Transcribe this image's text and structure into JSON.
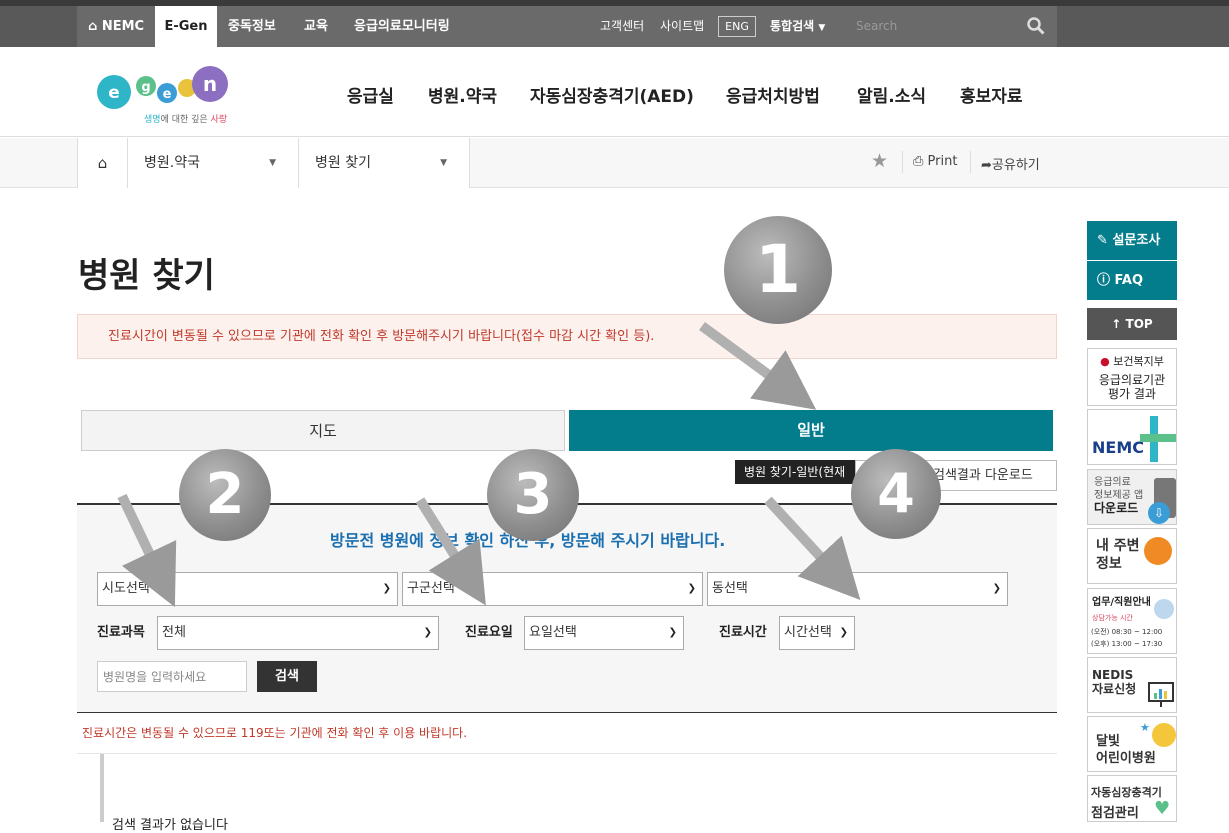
{
  "topbar": {
    "nav": [
      {
        "label": "NEMC",
        "icon": "home-icon"
      },
      {
        "label": "E-Gen"
      },
      {
        "label": "중독정보"
      },
      {
        "label": "교육"
      },
      {
        "label": "응급의료모니터링"
      }
    ],
    "links": {
      "customer": "고객센터",
      "sitemap": "사이트맵",
      "eng": "ENG",
      "integrated_search": "통합검색"
    },
    "search_placeholder": "Search"
  },
  "logo": {
    "tagline_1": "생명",
    "tagline_2": "에 대한 깊은 ",
    "tagline_3": "사랑"
  },
  "gnb": [
    "응급실",
    "병원.약국",
    "자동심장충격기(AED)",
    "응급처치방법",
    "알림.소식",
    "홍보자료"
  ],
  "breadcrumb": {
    "level1": "병원.약국",
    "level2": "병원 찾기",
    "print": "Print",
    "share": "공유하기"
  },
  "page": {
    "title": "병원 찾기",
    "notice": "진료시간이 변동될 수 있으므로 기관에 전화 확인 후 방문해주시기 바랍니다(접수 마감 시간 확인 등).",
    "tabs": {
      "map": "지도",
      "general": "일반"
    },
    "tooltip": "병원 찾기-일반(현재",
    "download": "검색결과 다운로드",
    "guide": "방문전 병원에 정보 확인 하신 후, 방문해 주시기 바랍니다.",
    "selects": {
      "sido": "시도선택",
      "gugun": "구군선택",
      "dong": "동선택",
      "dept": "전체",
      "day": "요일선택",
      "time": "시간선택"
    },
    "labels": {
      "dept": "진료과목",
      "day": "진료요일",
      "time": "진료시간"
    },
    "name_placeholder": "병원명을 입력하세요",
    "search_button": "검색",
    "warning": "진료시간은 변동될 수 있으므로 119또는 기관에 전화 확인 후 이용 바랍니다.",
    "result_message": "검색 결과가 없습니다"
  },
  "quick": {
    "survey": "설문조사",
    "faq": "FAQ",
    "top": "TOP",
    "banners": {
      "mohw_org": "보건복지부",
      "mohw_line1": "응급의료기관",
      "mohw_line2": "평가 결과",
      "nemc": "NEMC",
      "app_line1": "응급의료",
      "app_line2": "정보제공 앱",
      "app_line3": "다운로드",
      "near_line1": "내 주변",
      "near_line2": "정보",
      "hours_title": "업무/직원안내",
      "hours_sub": "상담가능 시간",
      "hours_am": "(오전) 08:30 ~ 12:00",
      "hours_pm": "(오후) 13:00 ~ 17:30",
      "nedis_line1": "NEDIS",
      "nedis_line2": "자료신청",
      "moon_line1": "달빛",
      "moon_line2": "어린이병원",
      "aed_line1": "자동심장충격기",
      "aed_line2": "점검관리"
    }
  },
  "annotations": [
    "1",
    "2",
    "3",
    "4"
  ],
  "colors": {
    "accent": "#037c8c",
    "notice_text": "#c0392b",
    "guide_text": "#1a6fb0",
    "topbar": "#595959"
  }
}
